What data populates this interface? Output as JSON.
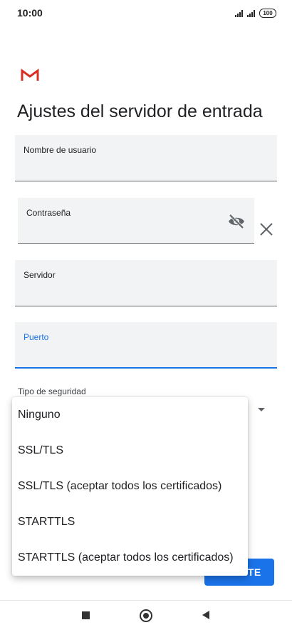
{
  "status_bar": {
    "time": "10:00",
    "battery": "100"
  },
  "app": {
    "logo_icon": "gmail-logo-icon",
    "brand_color": "#d93025"
  },
  "page": {
    "title": "Ajustes del servidor de entrada"
  },
  "fields": {
    "username": {
      "label": "Nombre de usuario",
      "value": ""
    },
    "password": {
      "label": "Contraseña",
      "value": "",
      "toggle_icon": "visibility-off-icon"
    },
    "server": {
      "label": "Servidor",
      "value": ""
    },
    "port": {
      "label": "Puerto",
      "value": ""
    }
  },
  "security": {
    "label": "Tipo de seguridad",
    "options": [
      "Ninguno",
      "SSL/TLS",
      "SSL/TLS (aceptar todos los certificados)",
      "STARTTLS",
      "STARTTLS (aceptar todos los certificados)"
    ]
  },
  "next_button": {
    "label": "SIGUIENTE",
    "visible_label": "NTE",
    "color": "#1a73e8"
  },
  "accent_color": "#1a73e8"
}
